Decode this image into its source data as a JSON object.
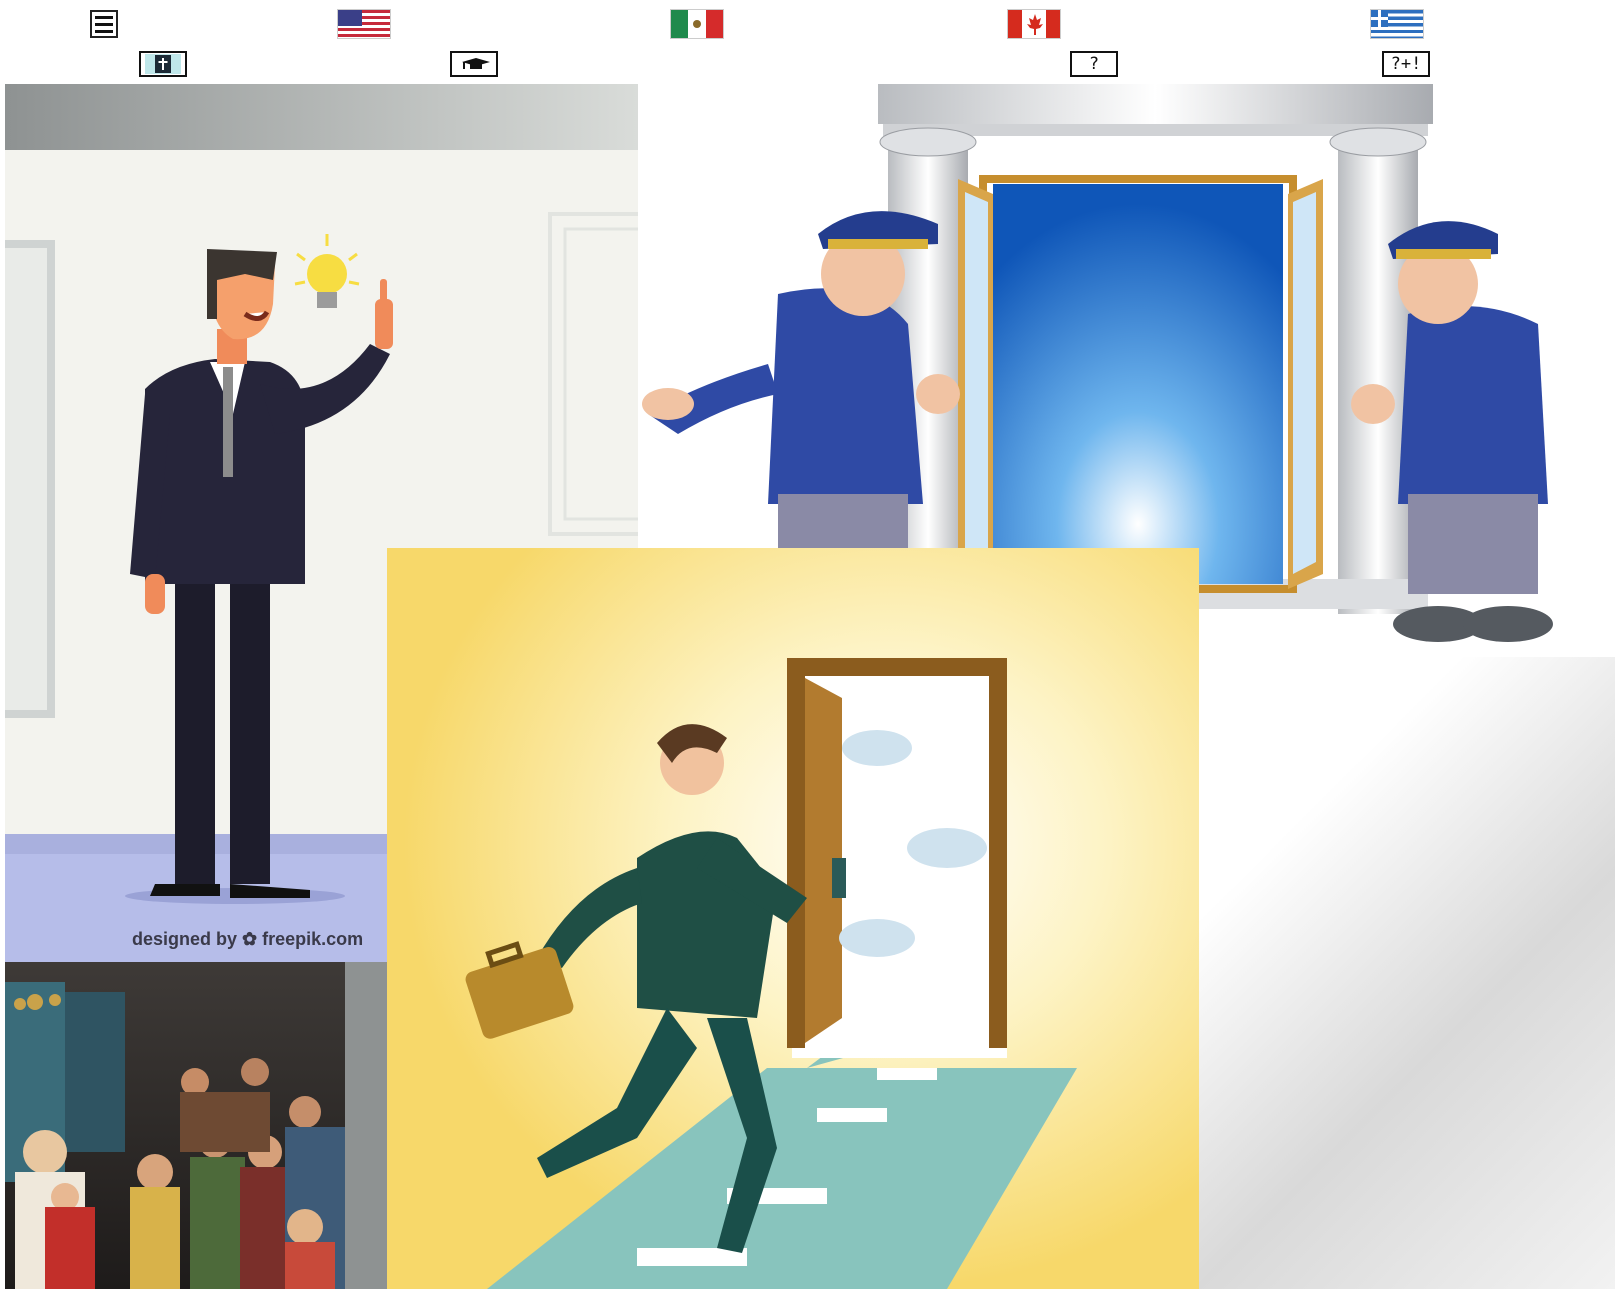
{
  "toolbar": {
    "menu_icon": "hamburger-menu-icon",
    "languages": [
      {
        "name": "english-us-flag-icon"
      },
      {
        "name": "spanish-mexico-flag-icon"
      },
      {
        "name": "french-canada-flag-icon"
      },
      {
        "name": "greek-flag-icon"
      }
    ],
    "subnav": {
      "bible_icon": "bible-icon",
      "graduation_icon": "graduation-cap-icon",
      "help_label": "?",
      "quiz_label": "?+!"
    }
  },
  "content": {
    "watermark": "designed by ✿ freepik.com",
    "images": [
      "businessman-idea-illustration",
      "doormen-opening-door-illustration",
      "man-walking-through-door-illustration",
      "biblical-gathering-painting"
    ]
  },
  "colors": {
    "us_red": "#c62a3b",
    "us_blue": "#3a3f88",
    "mexico_green": "#1f8a4c",
    "mexico_red": "#d52b2b",
    "canada_red": "#d52b1e",
    "greece_blue": "#2d6fbf"
  }
}
